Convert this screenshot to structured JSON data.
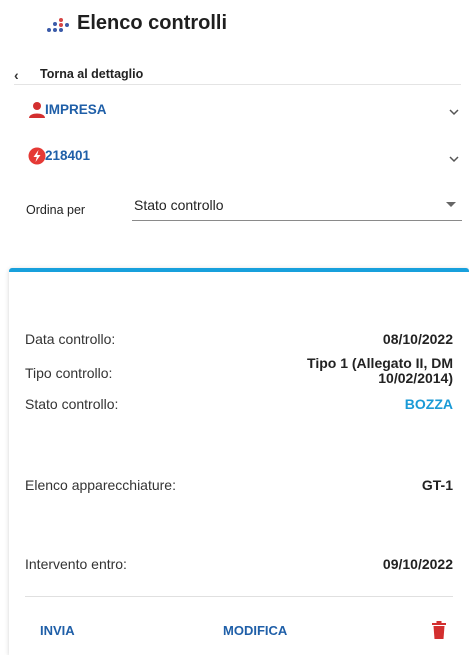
{
  "header": {
    "title": "Elenco controlli",
    "logo_icon": "dots-logo-icon"
  },
  "back": {
    "label": "Torna al dettaglio",
    "icon": "chevron-left-icon"
  },
  "accordions": [
    {
      "label": "IMPRESA",
      "icon": "person-icon",
      "icon_color": "#d32f2f"
    },
    {
      "label": "218401",
      "icon": "bolt-icon",
      "icon_color": "#e53935"
    }
  ],
  "sort": {
    "label": "Ordina per",
    "value": "Stato controllo"
  },
  "card": {
    "accent_color": "#18a0dc",
    "fields": {
      "data_label": "Data controllo:",
      "data_value": "08/10/2022",
      "tipo_label": "Tipo controllo:",
      "tipo_value": "Tipo 1 (Allegato II, DM 10/02/2014)",
      "stato_label": "Stato controllo:",
      "stato_value": "BOZZA",
      "apparecchiature_label": "Elenco apparecchiature:",
      "apparecchiature_value": "GT-1",
      "intervento_label": "Intervento entro:",
      "intervento_value": "09/10/2022"
    },
    "actions": {
      "invia": "INVIA",
      "modifica": "MODIFICA",
      "delete_icon": "trash-icon",
      "delete_color": "#d32f2f"
    }
  }
}
